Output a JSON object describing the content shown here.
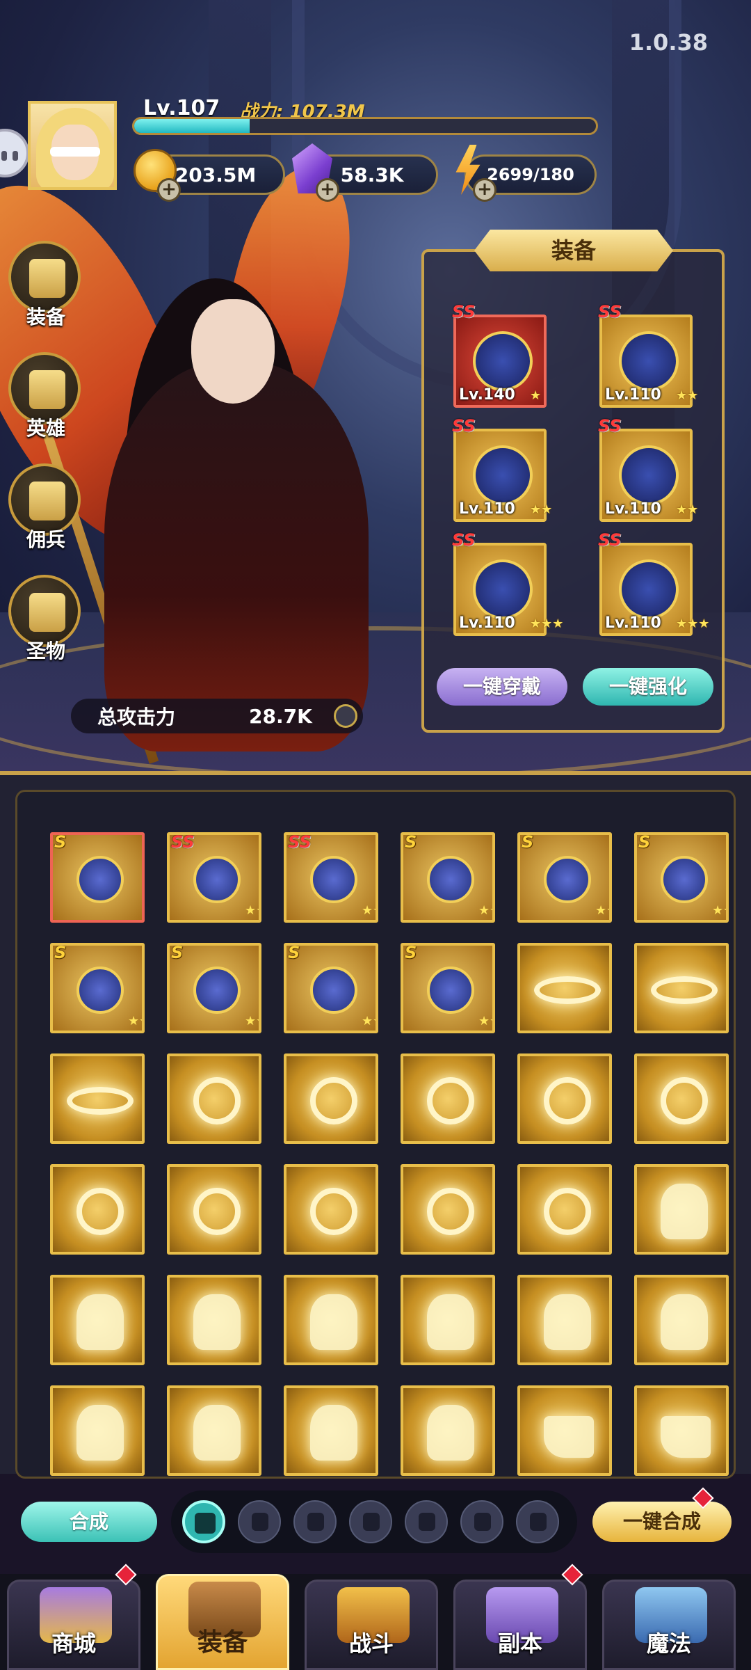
{
  "version": "1.0.38",
  "player": {
    "level": "Lv.107",
    "power_label": "战力:",
    "power_value": "107.3M",
    "exp_progress": 0.25
  },
  "resources": {
    "gold": "203.5M",
    "gems": "58.3K",
    "energy": "2699/180"
  },
  "side_nav": [
    "装备",
    "英雄",
    "佣兵",
    "圣物"
  ],
  "attack": {
    "label": "总攻击力",
    "value": "28.7K"
  },
  "equip_panel": {
    "title": "装备",
    "slots": [
      {
        "grade": "SS",
        "level": "Lv.140",
        "stars": 1,
        "icon": "staff-icon"
      },
      {
        "grade": "SS",
        "level": "Lv.110",
        "stars": 2,
        "icon": "wizard-hat-icon"
      },
      {
        "grade": "SS",
        "level": "Lv.110",
        "stars": 2,
        "icon": "belt-icon"
      },
      {
        "grade": "SS",
        "level": "Lv.110",
        "stars": 2,
        "icon": "robe-icon"
      },
      {
        "grade": "SS",
        "level": "Lv.110",
        "stars": 3,
        "icon": "necklace-icon"
      },
      {
        "grade": "SS",
        "level": "Lv.110",
        "stars": 3,
        "icon": "boots-icon"
      }
    ],
    "equip_all": "一键穿戴",
    "enhance_all": "一键强化"
  },
  "inventory": {
    "rows": [
      [
        {
          "grade": "S",
          "icon": "staff-icon",
          "stars": 0,
          "red": true
        },
        {
          "grade": "SS",
          "icon": "belt-icon",
          "stars": 2
        },
        {
          "grade": "SS",
          "icon": "robe-icon",
          "stars": 3
        },
        {
          "grade": "S",
          "icon": "belt-icon",
          "stars": 3
        },
        {
          "grade": "S",
          "icon": "necklace-icon",
          "stars": 3
        },
        {
          "grade": "S",
          "icon": "wizard-hat-icon",
          "stars": 3
        }
      ],
      [
        {
          "grade": "S",
          "icon": "boots-icon",
          "stars": 2
        },
        {
          "grade": "S",
          "icon": "robe-icon",
          "stars": 3
        },
        {
          "grade": "S",
          "icon": "robe-icon",
          "stars": 3
        },
        {
          "grade": "S",
          "icon": "necklace-icon",
          "stars": 3
        },
        {
          "icon": "ring"
        },
        {
          "icon": "ring"
        }
      ],
      [
        {
          "icon": "ring"
        },
        {
          "icon": "neck"
        },
        {
          "icon": "neck"
        },
        {
          "icon": "neck"
        },
        {
          "icon": "neck"
        },
        {
          "icon": "neck"
        }
      ],
      [
        {
          "icon": "neck"
        },
        {
          "icon": "neck"
        },
        {
          "icon": "neck"
        },
        {
          "icon": "neck"
        },
        {
          "icon": "neck"
        },
        {
          "icon": "cloak"
        }
      ],
      [
        {
          "icon": "cloak"
        },
        {
          "icon": "cloak"
        },
        {
          "icon": "cloak"
        },
        {
          "icon": "cloak"
        },
        {
          "icon": "cloak"
        },
        {
          "icon": "cloak"
        }
      ],
      [
        {
          "icon": "cloak"
        },
        {
          "icon": "cloak"
        },
        {
          "icon": "cloak"
        },
        {
          "icon": "cloak"
        },
        {
          "icon": "boot"
        },
        {
          "icon": "boot"
        }
      ]
    ]
  },
  "toolbar": {
    "merge": "合成",
    "merge_all": "一键合成",
    "filters": [
      "all-grid-icon",
      "staff-icon",
      "belt-icon",
      "necklace-icon",
      "robe-icon",
      "cloak-icon",
      "boots-icon"
    ]
  },
  "bottom_nav": [
    {
      "label": "商城",
      "badge": true
    },
    {
      "label": "装备",
      "active": true
    },
    {
      "label": "战斗"
    },
    {
      "label": "副本",
      "badge": true
    },
    {
      "label": "魔法"
    }
  ],
  "colors": {
    "gold": "#e8be4a",
    "accent_teal": "#2fb6b0",
    "badge_red": "#e6233a"
  }
}
